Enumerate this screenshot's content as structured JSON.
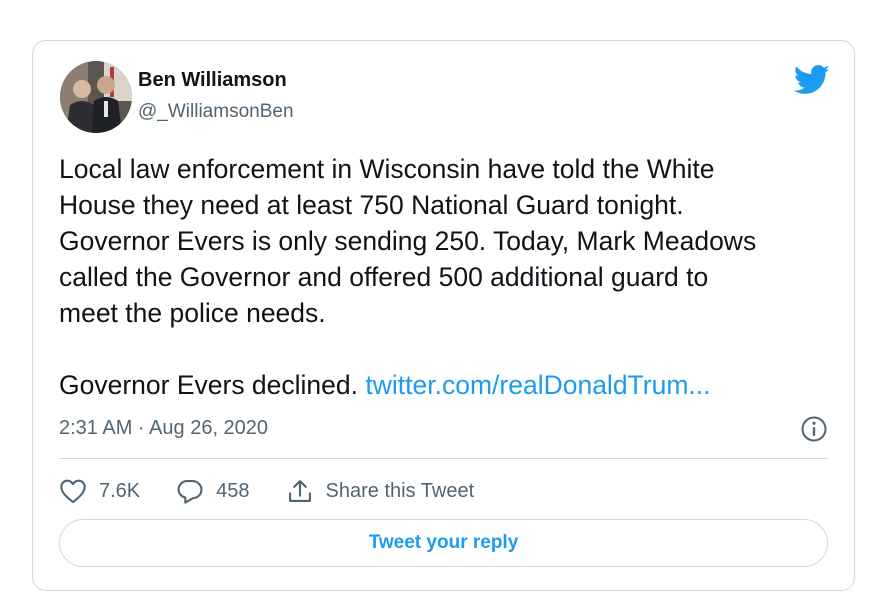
{
  "tweet": {
    "author_name": "Ben Williamson",
    "author_handle": "@_WilliamsonBen",
    "text_lines": [
      "Local law enforcement in Wisconsin have told the White",
      "House they need at least 750 National Guard tonight.",
      "Governor Evers is only sending 250. Today, Mark Meadows",
      "called the Governor and offered 500 additional guard to",
      "meet the police needs."
    ],
    "text_final": "Governor Evers declined.",
    "link_text": "twitter.com/realDonaldTrum...",
    "timestamp": "2:31 AM · Aug 26, 2020"
  },
  "actions": {
    "like_count": "7.6K",
    "reply_count": "458",
    "share_label": "Share this Tweet"
  },
  "reply_button_label": "Tweet your reply",
  "icons": {
    "twitter_bird": "twitter-bird-icon",
    "info": "info-icon",
    "like": "heart-icon",
    "reply": "speech-bubble-icon",
    "share": "share-icon"
  },
  "colors": {
    "brand": "#1d9bf0",
    "text": "#0f1419",
    "secondary": "#536471",
    "border": "#cfd9de"
  }
}
